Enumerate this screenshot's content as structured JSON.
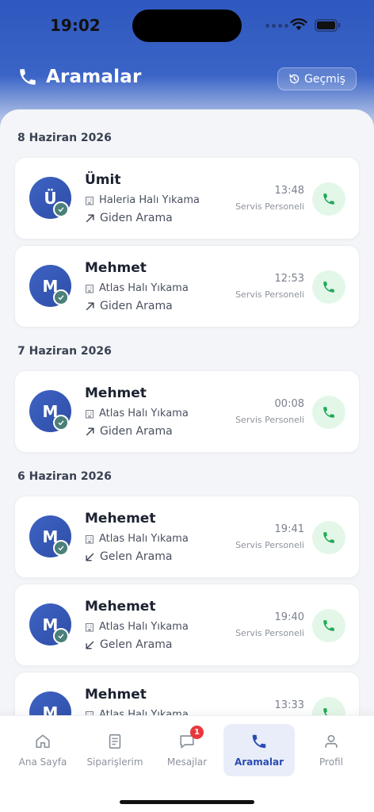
{
  "status": {
    "time": "19:02"
  },
  "header": {
    "title": "Aramalar",
    "history_label": "Geçmiş"
  },
  "groups": [
    {
      "date": "8 Haziran 2026",
      "calls": [
        {
          "initial": "Ü",
          "name": "Ümit",
          "company": "Haleria Halı Yıkama",
          "direction": "Giden Arama",
          "type": "outgoing",
          "time": "13:48",
          "role": "Servis Personeli"
        },
        {
          "initial": "M",
          "name": "Mehmet",
          "company": "Atlas Halı Yıkama",
          "direction": "Giden Arama",
          "type": "outgoing",
          "time": "12:53",
          "role": "Servis Personeli"
        }
      ]
    },
    {
      "date": "7 Haziran 2026",
      "calls": [
        {
          "initial": "M",
          "name": "Mehmet",
          "company": "Atlas Halı Yıkama",
          "direction": "Giden Arama",
          "type": "outgoing",
          "time": "00:08",
          "role": "Servis Personeli"
        }
      ]
    },
    {
      "date": "6 Haziran 2026",
      "calls": [
        {
          "initial": "M",
          "name": "Mehemet",
          "company": "Atlas Halı Yıkama",
          "direction": "Gelen Arama",
          "type": "incoming",
          "time": "19:41",
          "role": "Servis Personeli"
        },
        {
          "initial": "M",
          "name": "Mehemet",
          "company": "Atlas Halı Yıkama",
          "direction": "Gelen Arama",
          "type": "incoming",
          "time": "19:40",
          "role": "Servis Personeli"
        },
        {
          "initial": "M",
          "name": "Mehmet",
          "company": "Atlas Halı Yıkama",
          "direction": "",
          "type": "",
          "time": "13:33",
          "role": ""
        }
      ]
    }
  ],
  "tabs": [
    {
      "label": "Ana Sayfa",
      "icon": "home-icon"
    },
    {
      "label": "Siparişlerim",
      "icon": "orders-icon"
    },
    {
      "label": "Mesajlar",
      "icon": "messages-icon",
      "badge": "1"
    },
    {
      "label": "Aramalar",
      "icon": "phone-icon",
      "active": true
    },
    {
      "label": "Profil",
      "icon": "profile-icon"
    }
  ],
  "colors": {
    "primary": "#2f58bf",
    "call_green": "#1fa855",
    "call_bg": "#e3f7e9",
    "badge_red": "#e8383b"
  }
}
